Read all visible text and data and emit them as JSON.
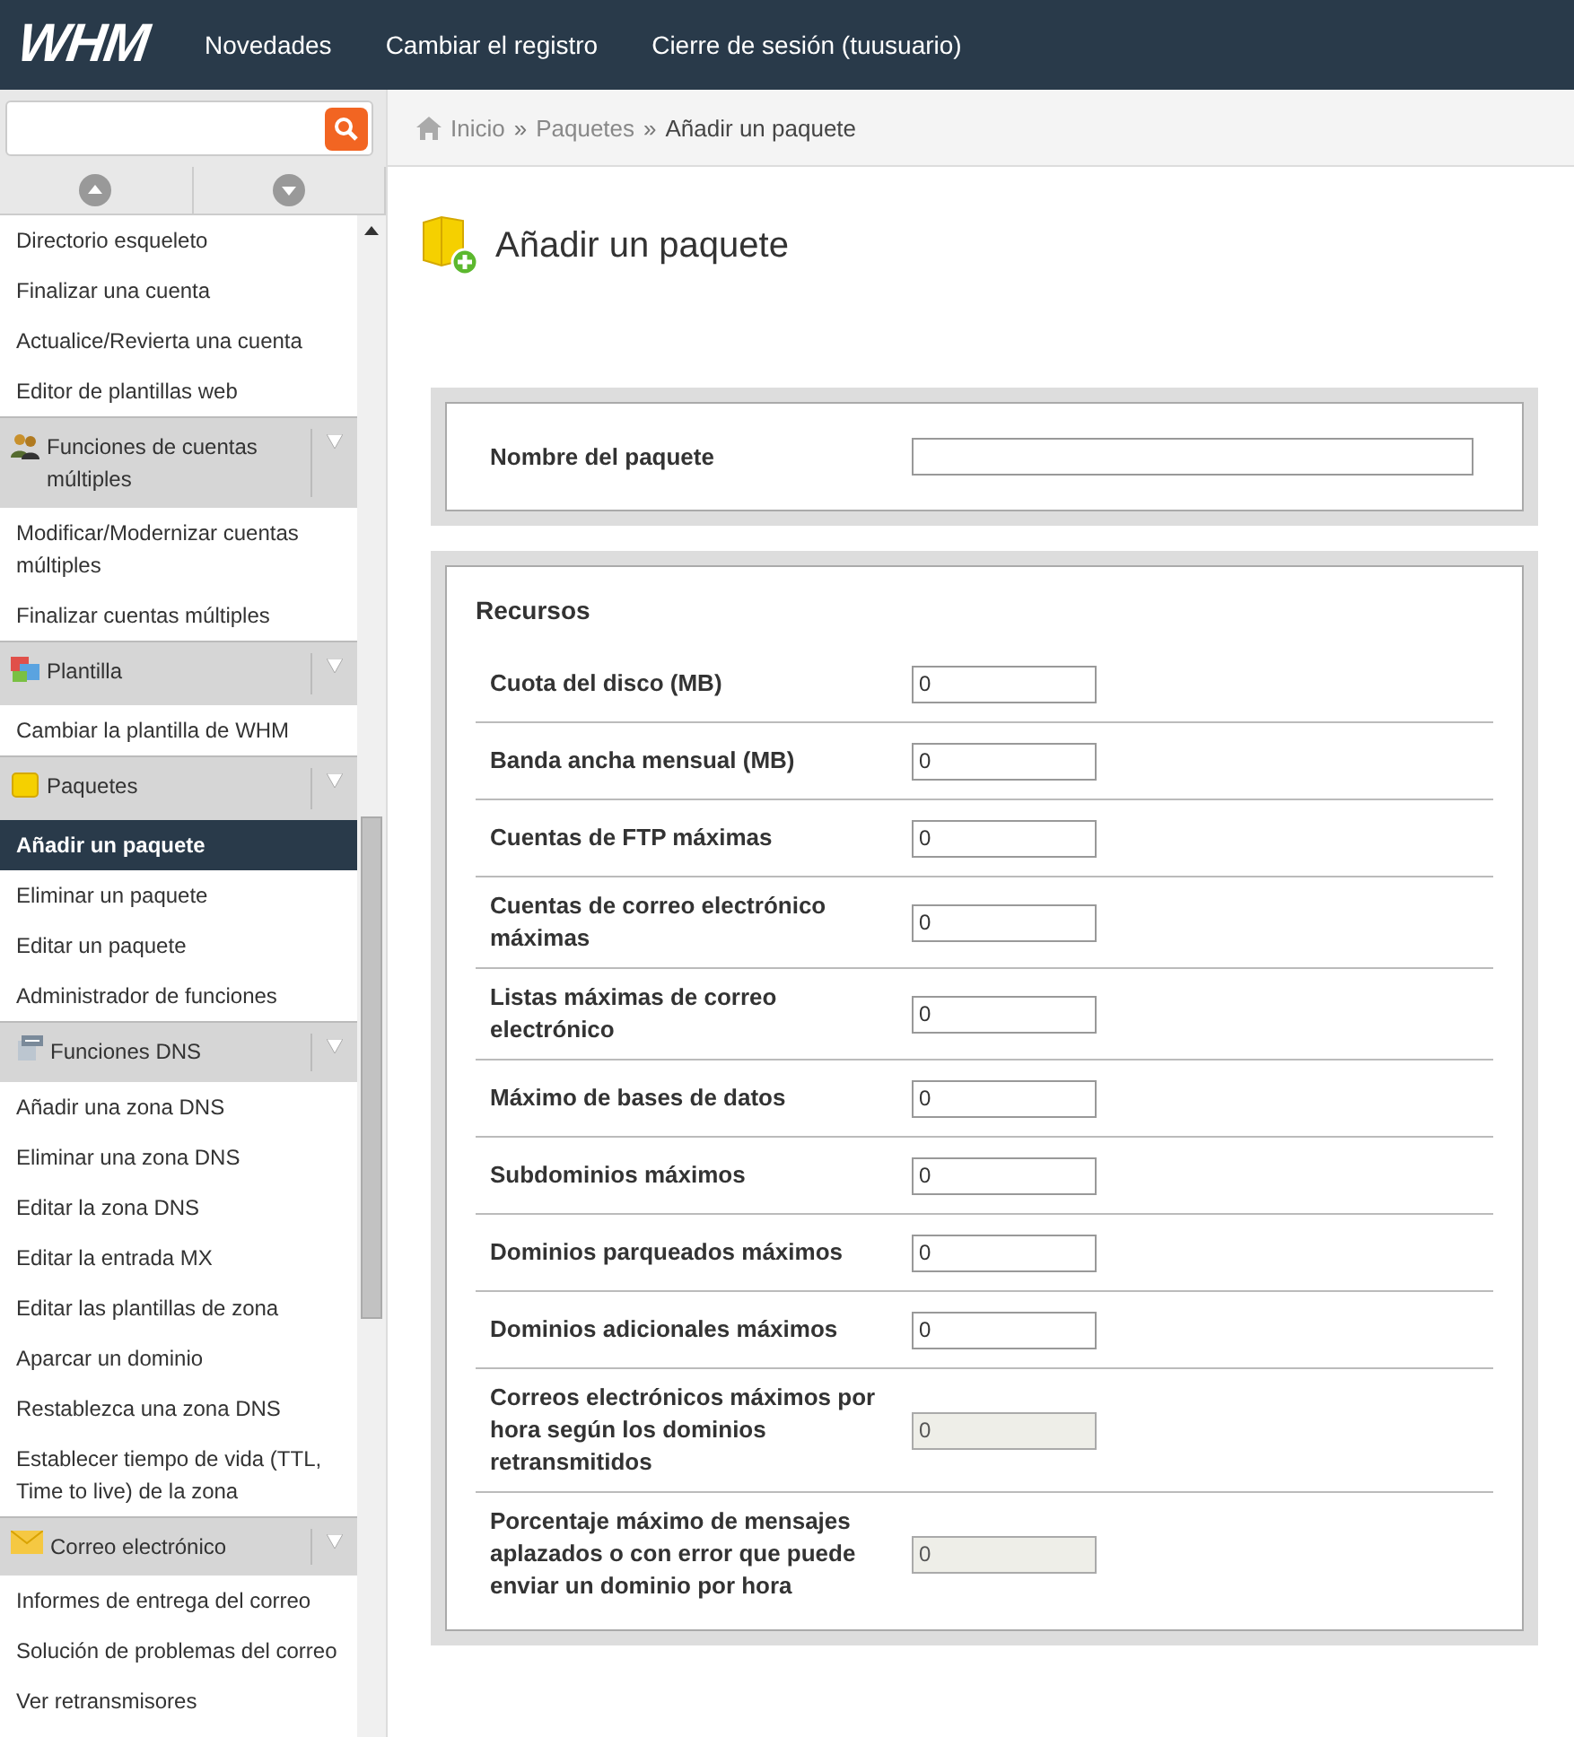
{
  "topbar": {
    "logo": "WHM",
    "links": [
      "Novedades",
      "Cambiar el registro",
      "Cierre de sesión (tuusuario)"
    ]
  },
  "breadcrumb": [
    {
      "label": "Inicio",
      "kind": "home"
    },
    {
      "label": "»",
      "kind": "separator"
    },
    {
      "label": "Paquetes",
      "kind": "link"
    },
    {
      "label": "»",
      "kind": "separator"
    },
    {
      "label": "Añadir un paquete",
      "kind": "current"
    }
  ],
  "sidebar": {
    "items": [
      {
        "kind": "link",
        "label": "Directorio esqueleto",
        "selected": false
      },
      {
        "kind": "link",
        "label": "Finalizar una cuenta",
        "selected": false
      },
      {
        "kind": "link",
        "label": "Actualice/Revierta una cuenta",
        "selected": false
      },
      {
        "kind": "link",
        "label": "Editor de plantillas web",
        "selected": false
      },
      {
        "kind": "section",
        "label": "Funciones de cuentas múltiples"
      },
      {
        "kind": "link",
        "label": "Modificar/Modernizar cuentas múltiples",
        "selected": false
      },
      {
        "kind": "link",
        "label": "Finalizar cuentas múltiples",
        "selected": false
      },
      {
        "kind": "section",
        "label": "Plantilla"
      },
      {
        "kind": "link",
        "label": "Cambiar la plantilla de WHM",
        "selected": false
      },
      {
        "kind": "section",
        "label": "Paquetes"
      },
      {
        "kind": "link",
        "label": "Añadir un paquete",
        "selected": true
      },
      {
        "kind": "link",
        "label": "Eliminar un paquete",
        "selected": false
      },
      {
        "kind": "link",
        "label": "Editar un paquete",
        "selected": false
      },
      {
        "kind": "link",
        "label": "Administrador de funciones",
        "selected": false
      },
      {
        "kind": "section",
        "label": "Funciones DNS"
      },
      {
        "kind": "link",
        "label": "Añadir una zona DNS",
        "selected": false
      },
      {
        "kind": "link",
        "label": "Eliminar una zona DNS",
        "selected": false
      },
      {
        "kind": "link",
        "label": "Editar la zona DNS",
        "selected": false
      },
      {
        "kind": "link",
        "label": "Editar la entrada MX",
        "selected": false
      },
      {
        "kind": "link",
        "label": "Editar las plantillas de zona",
        "selected": false
      },
      {
        "kind": "link",
        "label": "Aparcar un dominio",
        "selected": false
      },
      {
        "kind": "link",
        "label": "Restablezca una zona DNS",
        "selected": false
      },
      {
        "kind": "link",
        "label": "Establecer tiempo de vida (TTL, Time to live) de la zona",
        "selected": false
      },
      {
        "kind": "section",
        "label": "Correo electrónico"
      },
      {
        "kind": "link",
        "label": "Informes de entrega del correo",
        "selected": false
      },
      {
        "kind": "link",
        "label": "Solución de problemas del correo",
        "selected": false
      },
      {
        "kind": "link",
        "label": "Ver retransmisores",
        "selected": false
      }
    ]
  },
  "page": {
    "title": "Añadir un paquete"
  },
  "name_panel": {
    "label": "Nombre del paquete"
  },
  "resources": {
    "title": "Recursos",
    "rows": [
      {
        "label": "Cuota del disco (MB)",
        "value": "0",
        "disabled": false
      },
      {
        "label": "Banda ancha mensual (MB)",
        "value": "0",
        "disabled": false
      },
      {
        "label": "Cuentas de FTP máximas",
        "value": "0",
        "disabled": false
      },
      {
        "label": "Cuentas de correo electrónico máximas",
        "value": "0",
        "disabled": false
      },
      {
        "label": "Listas máximas de correo electrónico",
        "value": "0",
        "disabled": false
      },
      {
        "label": "Máximo de bases de datos",
        "value": "0",
        "disabled": false
      },
      {
        "label": "Subdominios máximos",
        "value": "0",
        "disabled": false
      },
      {
        "label": "Dominios parqueados máximos",
        "value": "0",
        "disabled": false
      },
      {
        "label": "Dominios adicionales máximos",
        "value": "0",
        "disabled": false
      },
      {
        "label": "Correos electrónicos máximos por hora según los dominios retransmitidos",
        "value": "0",
        "disabled": true
      },
      {
        "label": "Porcentaje máximo de mensajes aplazados o con error que puede enviar un dominio por hora",
        "value": "0",
        "disabled": true
      }
    ]
  }
}
